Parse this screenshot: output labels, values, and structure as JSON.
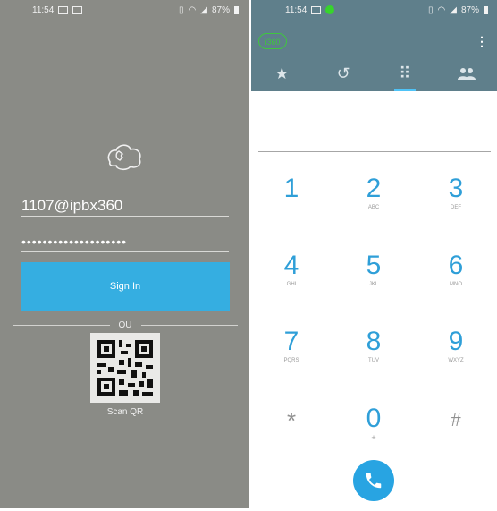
{
  "login": {
    "status_time": "11:54",
    "battery": "87%",
    "username": "1107@ipbx360",
    "password_mask": "••••••••••••••••••••",
    "signin_label": "Sign In",
    "separator_text": "OU",
    "scan_label": "Scan QR"
  },
  "dialer": {
    "status_time": "11:54",
    "battery": "87%",
    "account_badge": "i360",
    "keys": [
      {
        "digit": "1",
        "letters": ""
      },
      {
        "digit": "2",
        "letters": "ABC"
      },
      {
        "digit": "3",
        "letters": "DEF"
      },
      {
        "digit": "4",
        "letters": "GHI"
      },
      {
        "digit": "5",
        "letters": "JKL"
      },
      {
        "digit": "6",
        "letters": "MNO"
      },
      {
        "digit": "7",
        "letters": "PQRS"
      },
      {
        "digit": "8",
        "letters": "TUV"
      },
      {
        "digit": "9",
        "letters": "WXYZ"
      },
      {
        "digit": "*",
        "letters": ""
      },
      {
        "digit": "0",
        "letters": "+"
      },
      {
        "digit": "#",
        "letters": ""
      }
    ]
  },
  "colors": {
    "login_bg": "#8a8b86",
    "accent": "#35aee1",
    "header_bg": "#5f7f8b",
    "digit": "#2f9fd8"
  }
}
